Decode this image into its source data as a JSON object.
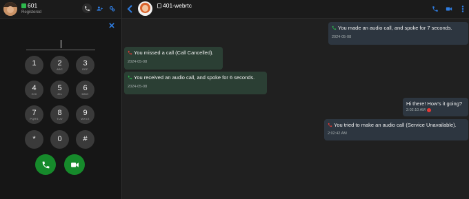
{
  "left_header": {
    "extension": "601",
    "status": "Registered",
    "icon_buttons": [
      "call-history-icon",
      "contacts-icon",
      "settings-icon"
    ]
  },
  "dialpad": {
    "input_value": "",
    "keys": [
      {
        "digit": "1",
        "letters": ""
      },
      {
        "digit": "2",
        "letters": "ABC"
      },
      {
        "digit": "3",
        "letters": "DEF"
      },
      {
        "digit": "4",
        "letters": "GHI"
      },
      {
        "digit": "5",
        "letters": "JKL"
      },
      {
        "digit": "6",
        "letters": "MNO"
      },
      {
        "digit": "7",
        "letters": "PQRS"
      },
      {
        "digit": "8",
        "letters": "TUV"
      },
      {
        "digit": "9",
        "letters": "WXYZ"
      },
      {
        "digit": "*",
        "letters": ""
      },
      {
        "digit": "0",
        "letters": ""
      },
      {
        "digit": "#",
        "letters": ""
      }
    ],
    "actions": [
      "audio-call-icon",
      "video-call-icon"
    ]
  },
  "chat_header": {
    "title": "401-webrtc"
  },
  "messages": [
    {
      "direction": "out",
      "icon": "audio-call-icon",
      "text": "You made an audio call, and spoke for 7 seconds.",
      "timestamp": "2024-05-08"
    },
    {
      "direction": "in",
      "icon": "missed-call-icon",
      "text": "You missed a call (Call Cancelled).",
      "timestamp": "2024-05-08"
    },
    {
      "direction": "in",
      "icon": "audio-call-icon",
      "text": "You received an audio call, and spoke for 6 seconds.",
      "timestamp": "2024-05-08"
    },
    {
      "direction": "out",
      "icon": "",
      "text": "Hi there! How's it going?",
      "timestamp": "2:02:10 AM",
      "status": "error-icon"
    },
    {
      "direction": "out",
      "icon": "failed-call-icon",
      "text": "You tried to make an audio call (Service Unavailable).",
      "timestamp": "2:02:42 AM"
    }
  ],
  "colors": {
    "accent_blue": "#2f7de1",
    "call_green": "#168a2b",
    "missed_red": "#e53935",
    "incoming_bubble": "#2b3f34",
    "outgoing_bubble": "#2d3640"
  }
}
